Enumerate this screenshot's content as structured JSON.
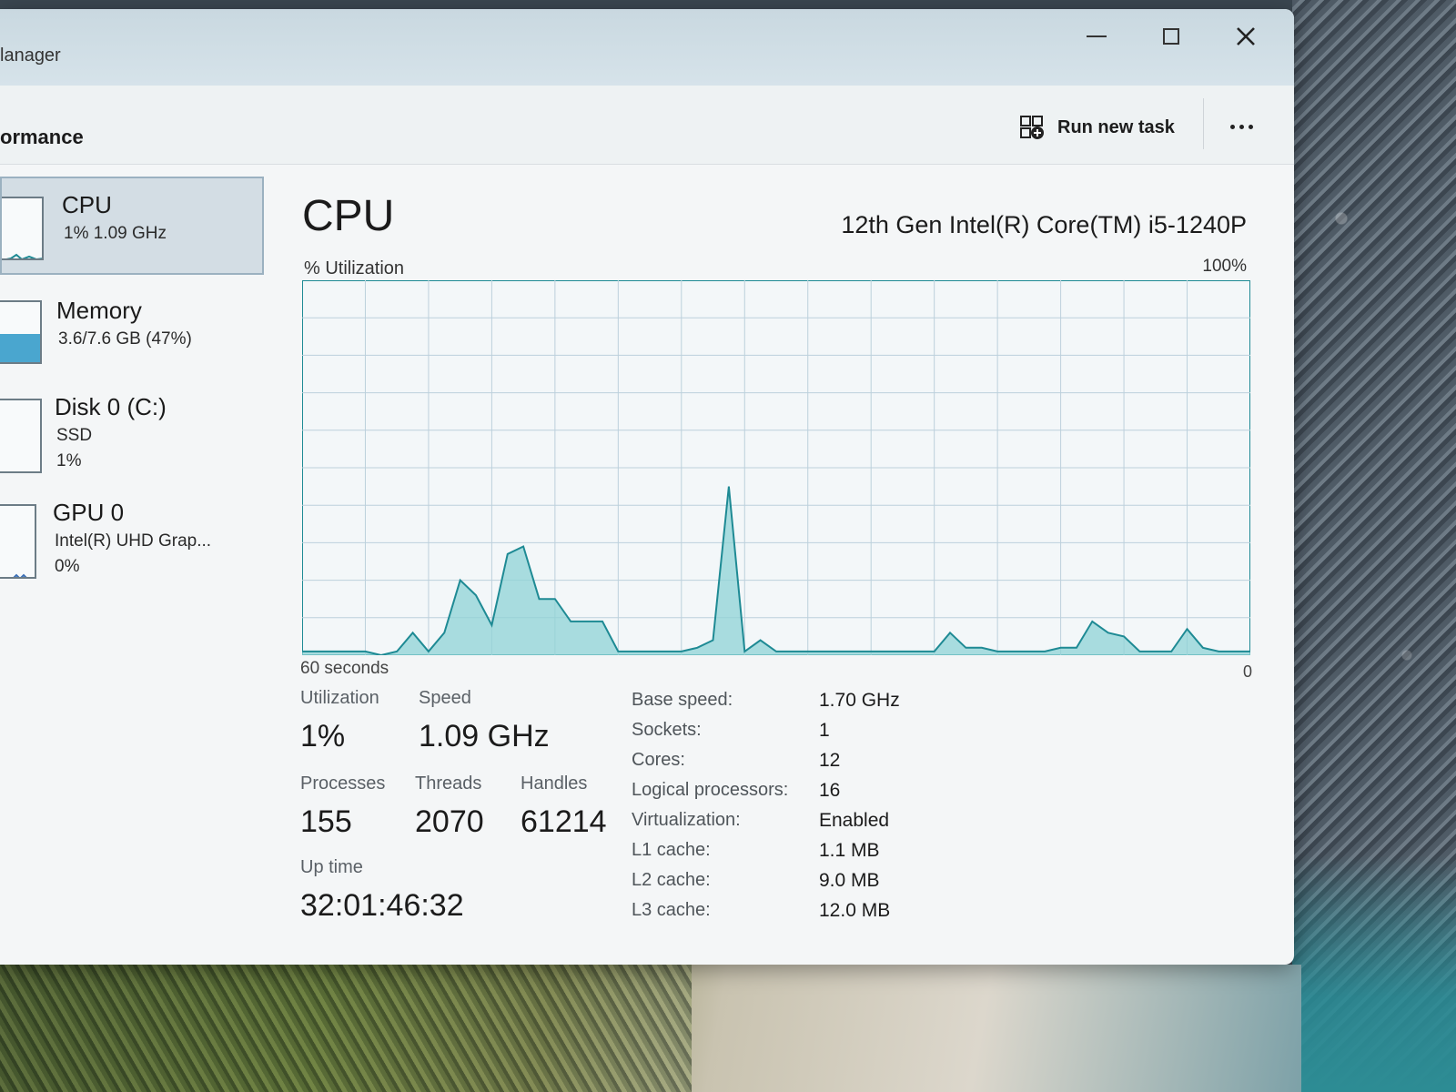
{
  "window": {
    "title": "lanager",
    "page_heading": "ormance"
  },
  "toolbar": {
    "run_new_task": "Run new task",
    "run_icon": "run-task-icon",
    "more_icon": "more-options-icon"
  },
  "sidebar": {
    "items": [
      {
        "name": "CPU",
        "sub1": "1%  1.09 GHz",
        "sub2": ""
      },
      {
        "name": "Memory",
        "sub1": "3.6/7.6 GB (47%)",
        "sub2": ""
      },
      {
        "name": "Disk 0 (C:)",
        "sub1": "SSD",
        "sub2": "1%"
      },
      {
        "name": "GPU 0",
        "sub1": "Intel(R) UHD Grap...",
        "sub2": "0%"
      }
    ],
    "memory_fill": 0.47
  },
  "main": {
    "title": "CPU",
    "model": "12th Gen Intel(R) Core(TM) i5-1240P",
    "util_label": "% Utilization",
    "max_label": "100%",
    "time_label": "60 seconds",
    "zero_label": "0"
  },
  "stats": {
    "utilization_label": "Utilization",
    "utilization": "1%",
    "speed_label": "Speed",
    "speed": "1.09 GHz",
    "processes_label": "Processes",
    "processes": "155",
    "threads_label": "Threads",
    "threads": "2070",
    "handles_label": "Handles",
    "handles": "61214",
    "uptime_label": "Up time",
    "uptime": "32:01:46:32"
  },
  "specs": [
    {
      "key": "Base speed:",
      "value": "1.70 GHz"
    },
    {
      "key": "Sockets:",
      "value": "1"
    },
    {
      "key": "Cores:",
      "value": "12"
    },
    {
      "key": "Logical processors:",
      "value": "16"
    },
    {
      "key": "Virtualization:",
      "value": "Enabled"
    },
    {
      "key": "L1 cache:",
      "value": "1.1 MB"
    },
    {
      "key": "L2 cache:",
      "value": "9.0 MB"
    },
    {
      "key": "L3 cache:",
      "value": "12.0 MB"
    }
  ],
  "colors": {
    "graph_line": "#1e8a94",
    "graph_fill": "#8fd3d6",
    "graph_grid": "#bcd0dc",
    "memory_fill": "#4aa6cf"
  },
  "chart_data": {
    "type": "area",
    "x_range": [
      60,
      0
    ],
    "ylim": [
      0,
      100
    ],
    "values": [
      1,
      1,
      1,
      1,
      1,
      0,
      1,
      6,
      1,
      6,
      20,
      16,
      8,
      27,
      29,
      15,
      15,
      9,
      9,
      9,
      1,
      1,
      1,
      1,
      1,
      2,
      4,
      45,
      1,
      4,
      1,
      1,
      1,
      1,
      1,
      1,
      1,
      1,
      1,
      1,
      1,
      6,
      2,
      2,
      1,
      1,
      1,
      1,
      2,
      2,
      9,
      6,
      5,
      1,
      1,
      1,
      7,
      2,
      1,
      1,
      1
    ]
  }
}
